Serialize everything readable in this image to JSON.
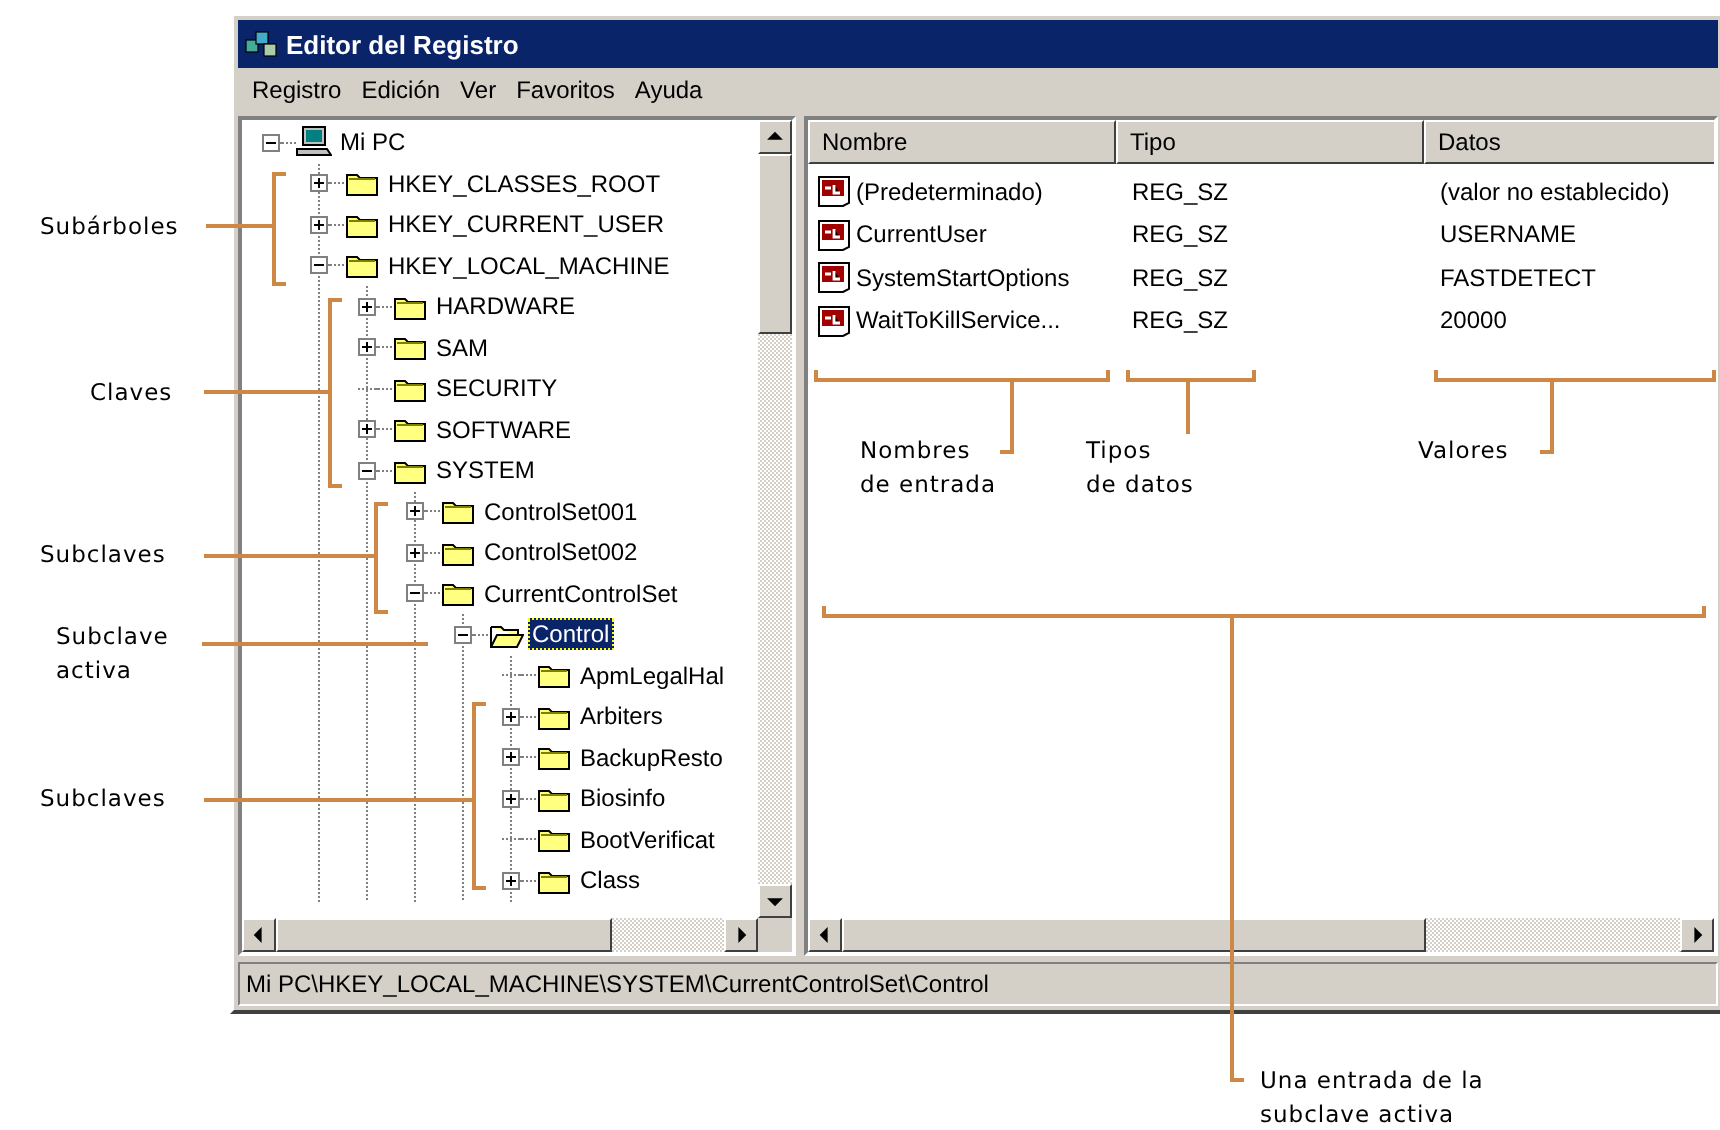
{
  "window": {
    "title": "Editor del Registro"
  },
  "menu": [
    "Registro",
    "Edición",
    "Ver",
    "Favoritos",
    "Ayuda"
  ],
  "tree": {
    "label": "Mi PC",
    "kind": "computer",
    "expanded": true,
    "selected": false,
    "children": [
      {
        "label": "HKEY_CLASSES_ROOT",
        "kind": "folder",
        "expanded": false,
        "selected": false
      },
      {
        "label": "HKEY_CURRENT_USER",
        "kind": "folder",
        "expanded": false,
        "selected": false
      },
      {
        "label": "HKEY_LOCAL_MACHINE",
        "kind": "folder",
        "expanded": true,
        "selected": false,
        "children": [
          {
            "label": "HARDWARE",
            "kind": "folder",
            "expanded": false,
            "selected": false
          },
          {
            "label": "SAM",
            "kind": "folder",
            "expanded": false,
            "selected": false
          },
          {
            "label": "SECURITY",
            "kind": "leaf",
            "selected": false
          },
          {
            "label": "SOFTWARE",
            "kind": "folder",
            "expanded": false,
            "selected": false
          },
          {
            "label": "SYSTEM",
            "kind": "folder",
            "expanded": true,
            "selected": false,
            "children": [
              {
                "label": "ControlSet001",
                "kind": "folder",
                "expanded": false,
                "selected": false
              },
              {
                "label": "ControlSet002",
                "kind": "folder",
                "expanded": false,
                "selected": false
              },
              {
                "label": "CurrentControlSet",
                "kind": "folder",
                "expanded": true,
                "selected": false,
                "children": [
                  {
                    "label": "Control",
                    "kind": "folder",
                    "expanded": true,
                    "selected": true,
                    "children": [
                      {
                        "label": "ApmLegalHal",
                        "kind": "leaf",
                        "selected": false
                      },
                      {
                        "label": "Arbiters",
                        "kind": "folder",
                        "expanded": false,
                        "selected": false
                      },
                      {
                        "label": "BackupResto",
                        "kind": "folder",
                        "expanded": false,
                        "selected": false
                      },
                      {
                        "label": "Biosinfo",
                        "kind": "folder",
                        "expanded": false,
                        "selected": false
                      },
                      {
                        "label": "BootVerificat",
                        "kind": "leaf",
                        "selected": false
                      },
                      {
                        "label": "Class",
                        "kind": "folder",
                        "expanded": false,
                        "selected": false
                      }
                    ]
                  }
                ]
              }
            ]
          }
        ]
      }
    ]
  },
  "list": {
    "columns": [
      "Nombre",
      "Tipo",
      "Datos"
    ],
    "rows": [
      {
        "name": "(Predeterminado)",
        "type": "REG_SZ",
        "data": "(valor no establecido)"
      },
      {
        "name": "CurrentUser",
        "type": "REG_SZ",
        "data": "USERNAME"
      },
      {
        "name": "SystemStartOptions",
        "type": "REG_SZ",
        "data": "FASTDETECT"
      },
      {
        "name": "WaitToKillService...",
        "type": "REG_SZ",
        "data": "20000"
      }
    ]
  },
  "status_bar": "Mi PC\\HKEY_LOCAL_MACHINE\\SYSTEM\\CurrentControlSet\\Control",
  "callouts": [
    {
      "lines": [
        "Subárboles"
      ]
    },
    {
      "lines": [
        "Claves"
      ]
    },
    {
      "lines": [
        "Subclaves"
      ]
    },
    {
      "lines": [
        "Subclave",
        "activa"
      ]
    },
    {
      "lines": [
        "Subclaves"
      ]
    },
    {
      "lines": [
        "Nombres",
        "de entrada"
      ]
    },
    {
      "lines": [
        "Tipos",
        "de datos"
      ]
    },
    {
      "lines": [
        "Valores"
      ]
    },
    {
      "lines": [
        "Una entrada de la",
        "subclave activa"
      ]
    }
  ]
}
